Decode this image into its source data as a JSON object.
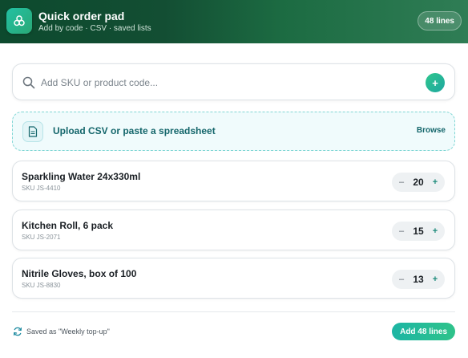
{
  "header": {
    "title": "Quick order pad",
    "subtitle": "Add by code · CSV · saved lists",
    "badge": "48 lines",
    "logo_icon": "sparkle-cluster-icon"
  },
  "search": {
    "placeholder": "Add SKU or product code...",
    "value": "",
    "add_label": "+"
  },
  "upload": {
    "label": "Upload CSV or paste a spreadsheet",
    "browse_label": "Browse"
  },
  "items": [
    {
      "name": "Sparkling Water 24x330ml",
      "sku": "SKU JS-4410",
      "qty": "20"
    },
    {
      "name": "Kitchen Roll, 6 pack",
      "sku": "SKU JS-2071",
      "qty": "15"
    },
    {
      "name": "Nitrile Gloves, box of 100",
      "sku": "SKU JS-8830",
      "qty": "13"
    }
  ],
  "stepper": {
    "minus": "–",
    "plus": "+"
  },
  "footer": {
    "saved_text": "Saved as \"Weekly top-up\"",
    "submit_label": "Add 48 lines"
  },
  "colors": {
    "header_dark": "#0d4a2e",
    "accent_teal": "#1db5a4",
    "accent_green": "#2fc38a",
    "link_teal": "#14666b"
  }
}
